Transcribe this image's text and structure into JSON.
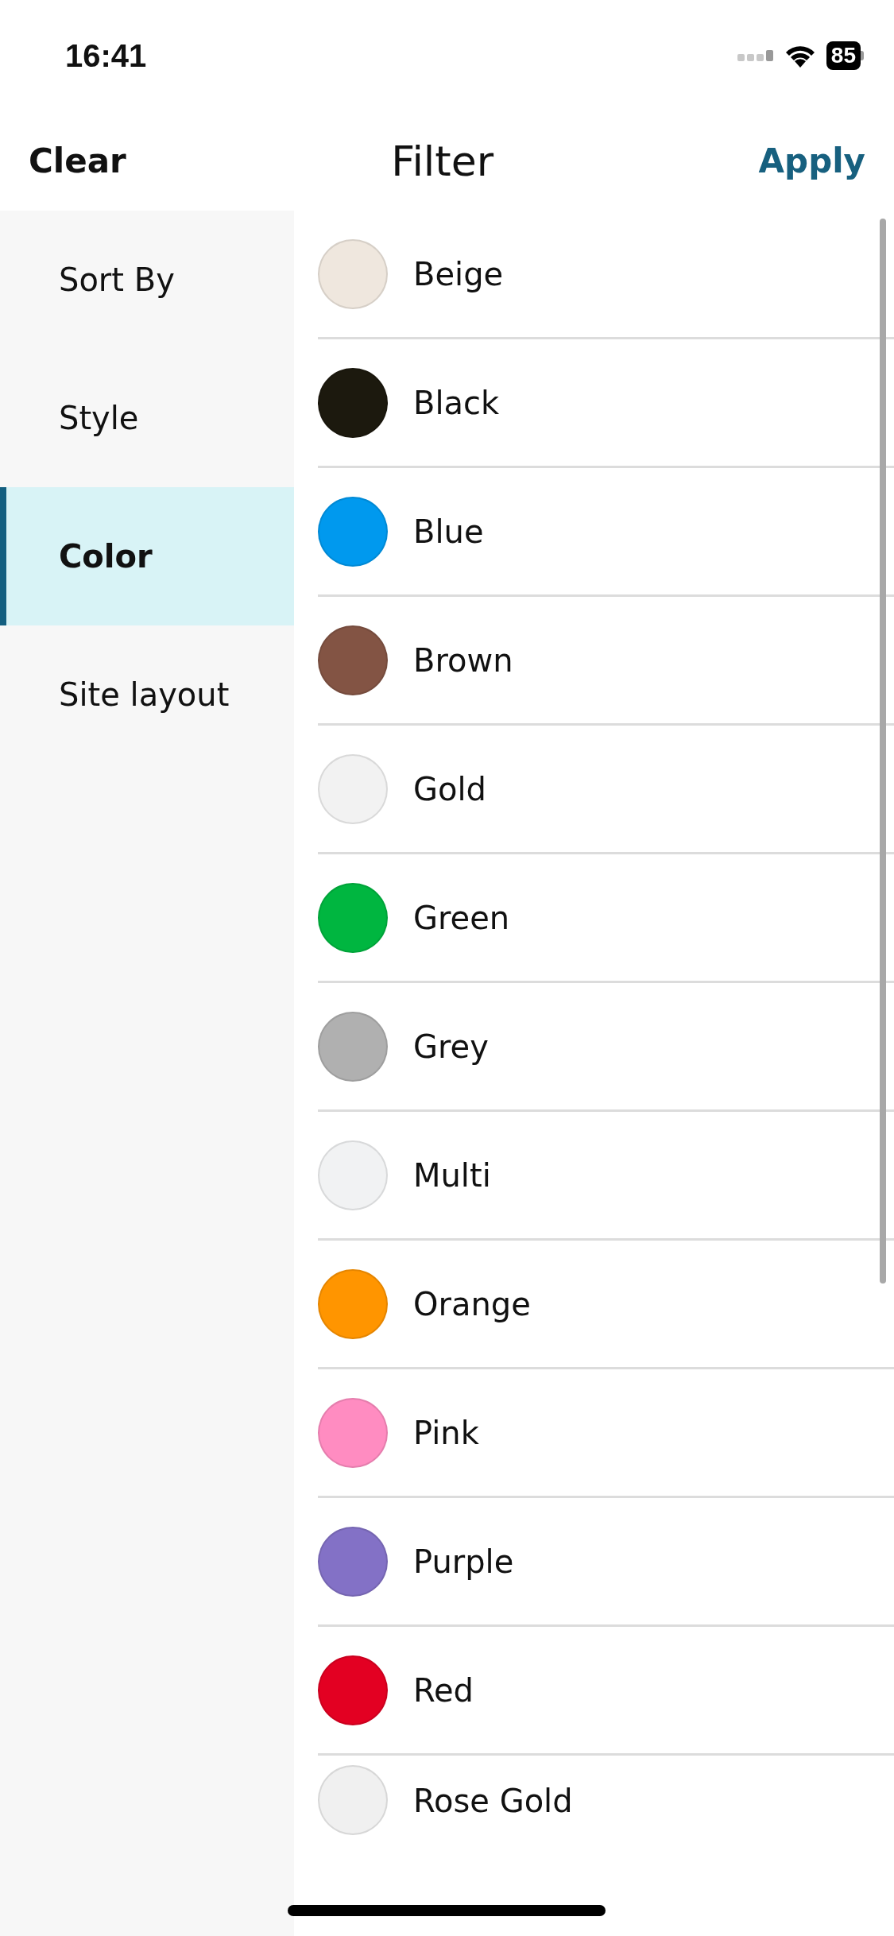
{
  "status_bar": {
    "time": "16:41",
    "battery": "85"
  },
  "header": {
    "clear": "Clear",
    "title": "Filter",
    "apply": "Apply"
  },
  "sidebar": {
    "items": [
      {
        "label": "Sort By",
        "selected": false
      },
      {
        "label": "Style",
        "selected": false
      },
      {
        "label": "Color",
        "selected": true
      },
      {
        "label": "Site layout",
        "selected": false
      }
    ]
  },
  "colors": [
    {
      "label": "Beige",
      "color": "#efe7de"
    },
    {
      "label": "Black",
      "color": "#1c190e"
    },
    {
      "label": "Blue",
      "color": "#0099ee"
    },
    {
      "label": "Brown",
      "color": "#835444"
    },
    {
      "label": "Gold",
      "color": "#f2f2f2"
    },
    {
      "label": "Green",
      "color": "#00b640"
    },
    {
      "label": "Grey",
      "color": "#b0b0b0"
    },
    {
      "label": "Multi",
      "color": "#f1f2f3"
    },
    {
      "label": "Orange",
      "color": "#ff9500"
    },
    {
      "label": "Pink",
      "color": "#ff8cc1"
    },
    {
      "label": "Purple",
      "color": "#8371c6"
    },
    {
      "label": "Red",
      "color": "#e30022"
    },
    {
      "label": "Rose Gold",
      "color": "#f0f0f0"
    }
  ]
}
